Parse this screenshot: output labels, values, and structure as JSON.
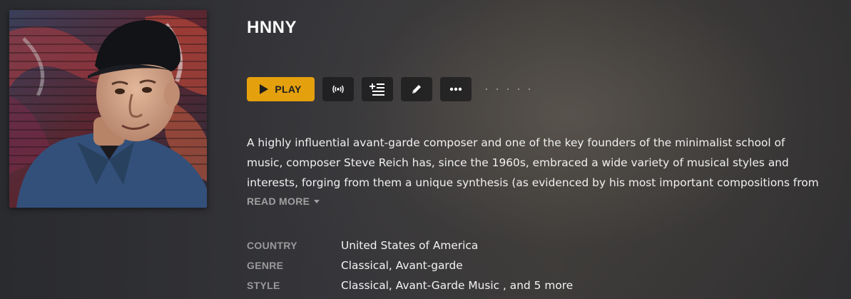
{
  "artist": {
    "name": "HNNY"
  },
  "toolbar": {
    "play_label": "PLAY",
    "buttons": [
      {
        "icon": "radio-icon"
      },
      {
        "icon": "add-to-playlist-icon"
      },
      {
        "icon": "edit-pencil-icon"
      },
      {
        "icon": "more-options-icon"
      }
    ],
    "accent_color": "#e5a00d"
  },
  "summary": {
    "lines": [
      "A highly influential avant-garde composer and one of the key founders of the minimalist school of",
      "music, composer Steve Reich has, since the 1960s, embraced a wide variety of musical styles and",
      "interests, forging from them a unique synthesis (as evidenced by his most important compositions from"
    ],
    "read_more_label": "READ MORE"
  },
  "metadata": [
    {
      "label": "COUNTRY",
      "value": "United States of America"
    },
    {
      "label": "GENRE",
      "value": "Classical, Avant-garde"
    },
    {
      "label": "STYLE",
      "value": "Classical, Avant-Garde Music , and 5 more"
    }
  ]
}
